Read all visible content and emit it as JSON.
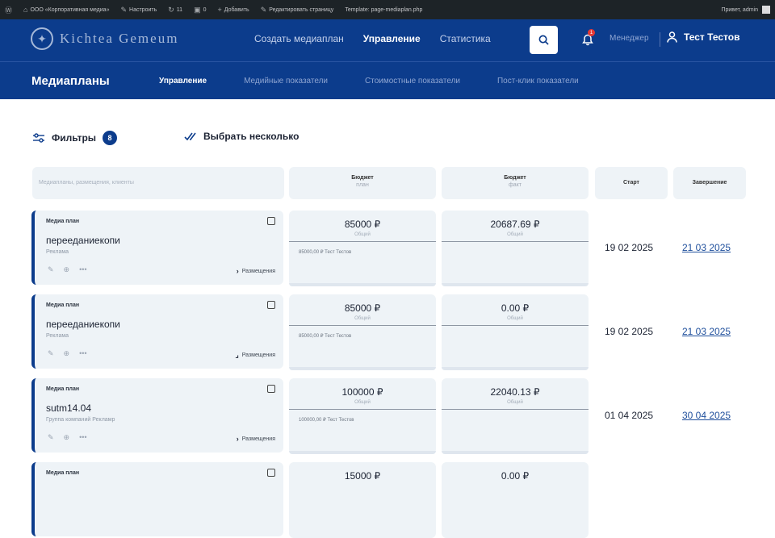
{
  "wpbar": {
    "site_name": "ООО «Корпоративная медиа»",
    "customize": "Настроить",
    "updates": "11",
    "comments": "0",
    "add": "Добавить",
    "edit_page": "Редактировать страницу",
    "template": "Template: page-mediaplan.php",
    "greeting": "Привет, admin"
  },
  "header": {
    "logo_text": "Kichtea Gemeum",
    "nav": [
      "Создать медиаплан",
      "Управление",
      "Статистика"
    ],
    "notifications_count": "1",
    "role": "Менеджер",
    "user_name": "Тест Тестов"
  },
  "subheader": {
    "title": "Медиапланы",
    "tabs": [
      "Управление",
      "Медийные показатели",
      "Стоимостные показатели",
      "Пост-клик показатели"
    ]
  },
  "toolbar": {
    "filters_label": "Фильтры",
    "filters_count": "8",
    "multi_select_label": "Выбрать несколько"
  },
  "columns": {
    "search_placeholder": "Медиапланы, размещения, клиенты",
    "budget_plan": "Бюджет",
    "budget_plan_sub": "план",
    "budget_fact": "Бюджет",
    "budget_fact_sub": "факт",
    "start": "Старт",
    "end": "Завершение"
  },
  "rows": [
    {
      "kind": "Медиа план",
      "name": "переедание­копи",
      "client": "Реклама",
      "placements_label": "Размещения",
      "plan_value": "85000 ₽",
      "plan_sub": "Общий",
      "plan_detail": "85000,00 ₽  Тест Тестов",
      "fact_value": "20687.69 ₽",
      "fact_sub": "Общий",
      "start": "19 02 2025",
      "end": "21 03 2025"
    },
    {
      "kind": "Медиа план",
      "name": "переедание­копи",
      "client": "Реклама",
      "placements_label": "Размещения",
      "plan_value": "85000 ₽",
      "plan_sub": "Общий",
      "plan_detail": "85000,00 ₽  Тест Тестов",
      "fact_value": "0.00 ₽",
      "fact_sub": "Общий",
      "start": "19 02 2025",
      "end": "21 03 2025"
    },
    {
      "kind": "Медиа план",
      "name": "sutm14.04",
      "client": "Группа компаний Рекламр",
      "placements_label": "Размещения",
      "plan_value": "100000 ₽",
      "plan_sub": "Общий",
      "plan_detail": "100000,00 ₽  Тест Тестов",
      "fact_value": "22040.13 ₽",
      "fact_sub": "Общий",
      "start": "01 04 2025",
      "end": "30 04 2025"
    },
    {
      "kind": "Медиа план",
      "name": "",
      "client": "",
      "placements_label": "",
      "plan_value": "15000 ₽",
      "plan_sub": "",
      "plan_detail": "",
      "fact_value": "0.00 ₽",
      "fact_sub": "",
      "start": "",
      "end": ""
    }
  ]
}
